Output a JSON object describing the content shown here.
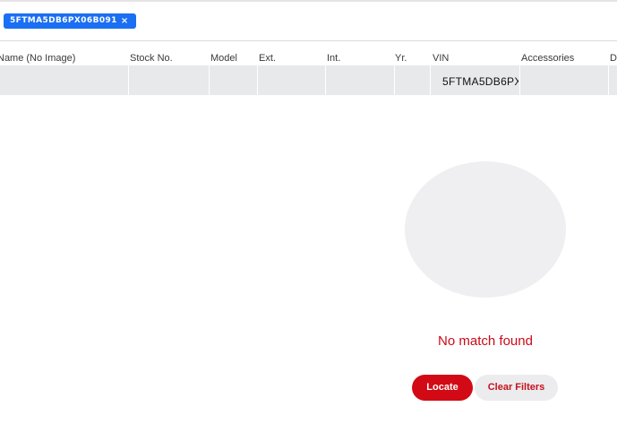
{
  "filter_chip": {
    "label": "5FTMA5DB6PX06B091",
    "close_glyph": "×"
  },
  "table": {
    "columns": [
      "Name (No Image)",
      "Stock No.",
      "Model",
      "Ext.",
      "Int.",
      "Yr.",
      "VIN",
      "Accessories",
      "D"
    ],
    "rows": [
      {
        "name": "",
        "stock_no": "",
        "model": "",
        "ext": "",
        "int": "",
        "yr": "",
        "vin": "5FTMA5DB6PX",
        "accessories": ""
      }
    ]
  },
  "empty_state": {
    "message": "No match found"
  },
  "actions": {
    "locate_label": "Locate",
    "clear_filters_label": "Clear Filters"
  },
  "colors": {
    "chip_blue": "#1a6ff2",
    "brand_red": "#d20a16",
    "row_gray": "#e8e9ea"
  }
}
